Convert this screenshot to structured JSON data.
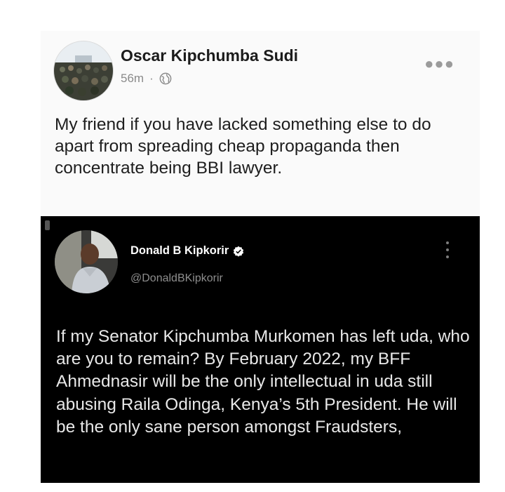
{
  "facebook_post": {
    "author": "Oscar Kipchumba Sudi",
    "time": "56m",
    "separator": "·",
    "more_icon": "more-horizontal-icon",
    "text": "My friend if you have lacked something else to do apart from spreading cheap propaganda then concentrate being BBI lawyer."
  },
  "tweet": {
    "name": "Donald B Kipkorir",
    "handle": "@DonaldBKipkorir",
    "text": "If my Senator Kipchumba Murkomen has left uda, who are you to remain?  By February 2022, my BFF Ahmednasir will be the only intellectual in uda still abusing Raila Odinga, Kenya’s 5th President. He will be the only sane person amongst Fraudsters,"
  },
  "colors": {
    "tweet_background": "#000000",
    "facebook_background": "#fafafa",
    "verified_badge": "#ffffff"
  }
}
